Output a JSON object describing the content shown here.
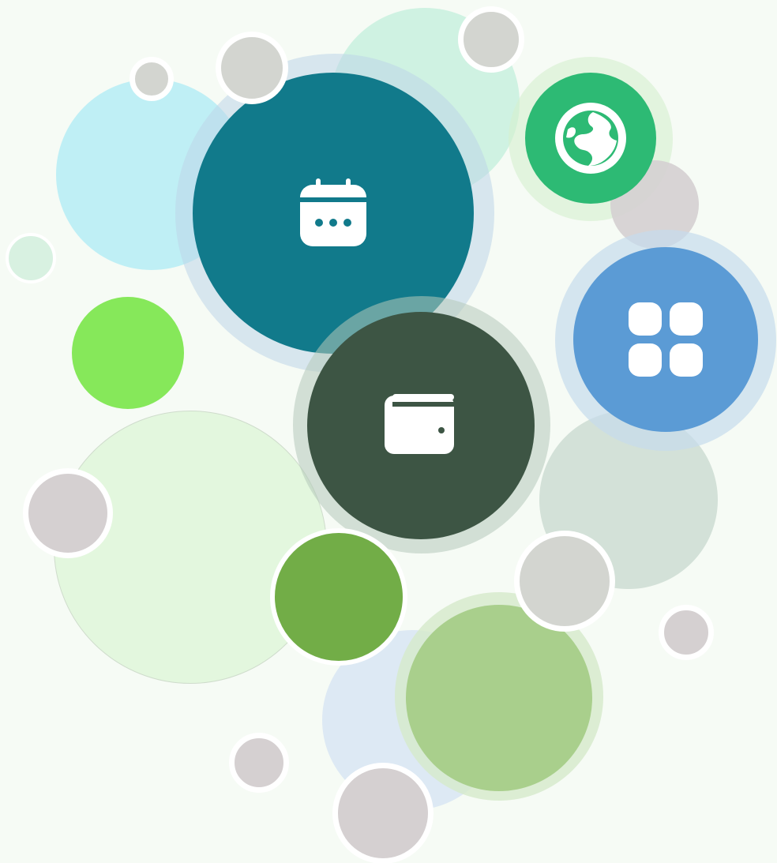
{
  "colors": {
    "background": "#f6fbf5",
    "calendar_bubble": "#117a8b",
    "wallet_bubble": "#3d5544",
    "globe_bubble": "#2dba74",
    "apps_bubble": "#5b9bd5",
    "lime_bubble": "#86e85a",
    "mid_green_bubble": "#72ad47",
    "sage_bubble": "#a9cf8c",
    "mint_bubble": "#cff2e2",
    "sky_bubble": "#bfeff5",
    "pale_green_bubble": "#e3f7de",
    "pale_blue_bubble": "#dde9f4",
    "gray_green_bubble": "#d3e1d8",
    "neutral_gray_bubble": "#d3d5d0",
    "mauve_gray_bubble": "#d5d0d1"
  },
  "icons": {
    "calendar": "calendar-icon",
    "wallet": "wallet-icon",
    "globe": "globe-icon",
    "apps": "apps-grid-icon"
  }
}
